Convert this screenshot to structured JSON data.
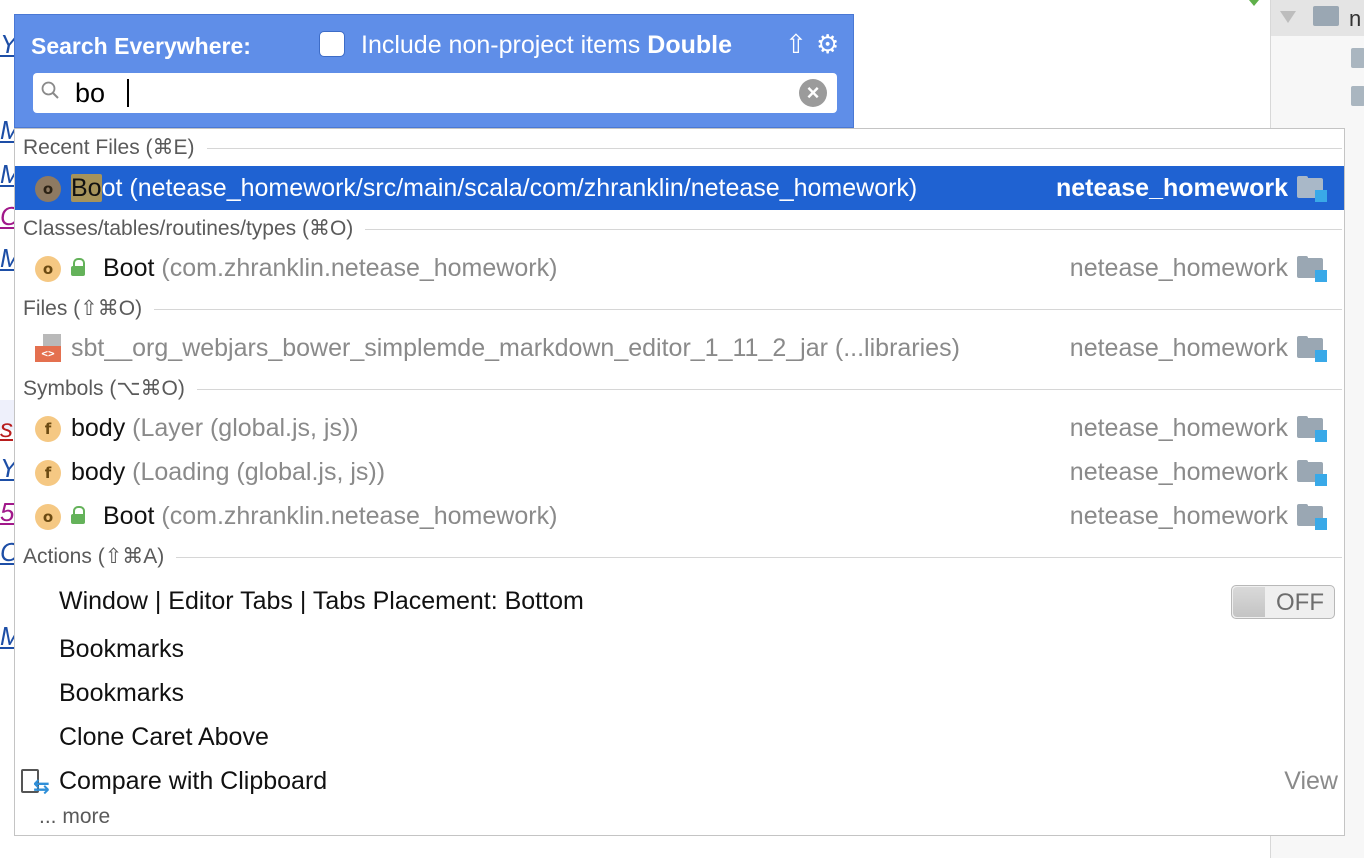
{
  "background": {
    "editor_fragments": [
      "Y",
      "M",
      "M",
      "C",
      "M",
      "s",
      "Y",
      "5",
      "C",
      "M"
    ],
    "tree_label": "n"
  },
  "header": {
    "title": "Search Everywhere:",
    "include_label": "Include non-project items",
    "shortcut_label": "Double",
    "shortcut_symbol": "⇧",
    "include_checked": false
  },
  "search": {
    "value": "bo",
    "placeholder": ""
  },
  "sections": {
    "recent": "Recent Files (⌘E)",
    "classes": "Classes/tables/routines/types (⌘O)",
    "files": "Files (⇧⌘O)",
    "symbols": "Symbols (⌥⌘O)",
    "actions": "Actions (⇧⌘A)"
  },
  "results": {
    "recent": [
      {
        "badge": "o",
        "match": "Bo",
        "rest": "ot",
        "context": "(netease_homework/src/main/scala/com/zhranklin/netease_homework)",
        "module": "netease_homework",
        "selected": true
      }
    ],
    "classes": [
      {
        "badge": "o",
        "name": "Boot",
        "context": "(com.zhranklin.netease_homework)",
        "module": "netease_homework"
      }
    ],
    "files": [
      {
        "icon_text": "<>",
        "name": "sbt__org_webjars_bower_simplemde_markdown_editor_1_11_2_jar",
        "context": "(...libraries)",
        "module": "netease_homework"
      }
    ],
    "symbols": [
      {
        "badge": "f",
        "name": "body",
        "context": "(Layer (global.js, js))",
        "module": "netease_homework"
      },
      {
        "badge": "f",
        "name": "body",
        "context": "(Loading (global.js, js))",
        "module": "netease_homework"
      },
      {
        "badge": "o",
        "name": "Boot",
        "context": "(com.zhranklin.netease_homework)",
        "module": "netease_homework"
      }
    ]
  },
  "actions": [
    {
      "label": "Window | Editor Tabs | Tabs Placement: Bottom",
      "toggle": "OFF"
    },
    {
      "label": "Bookmarks"
    },
    {
      "label": "Bookmarks"
    },
    {
      "label": "Clone Caret Above"
    },
    {
      "label": "Compare with Clipboard",
      "group": "View"
    }
  ],
  "more_label": "... more",
  "colors": {
    "header_bg": "#5f8ee8",
    "selection_bg": "#1f62d2",
    "match_highlight": "#a6935b",
    "badge_orange": "#f5c883",
    "module_square": "#39a9e8"
  },
  "icons": {
    "search": "search-icon",
    "clear": "clear-icon",
    "settings": "gear-icon",
    "lock": "lock-icon",
    "module_folder": "module-folder-icon",
    "compare": "clipboard-compare-icon"
  }
}
